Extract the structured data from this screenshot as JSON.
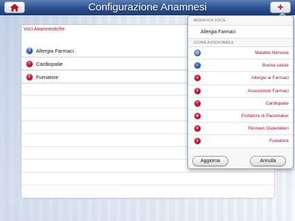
{
  "header": {
    "title": "Configurazione Anamnesi"
  },
  "main": {
    "section_label": "Voci Anamnestiche",
    "items": [
      {
        "label": "Allergia Farmaci",
        "icon": "allergy-pill-icon"
      },
      {
        "label": "Cardiopatie",
        "icon": "heartbeat-icon"
      },
      {
        "label": "Fumatore",
        "icon": "cigarette-icon"
      }
    ]
  },
  "popover": {
    "edit_label": "MODIFICA VOCE",
    "edit_value": "Allergia Farmaci",
    "icons_label": "ICONA ASSOCIABILE",
    "icons": [
      {
        "label": "Malattie Nervose",
        "icon": "brain-icon"
      },
      {
        "label": "Buona salute",
        "icon": "thermometer-icon"
      },
      {
        "label": "Allergie ai Farmaci",
        "icon": "allergy-pill-icon"
      },
      {
        "label": "Assunzione Farmaci",
        "icon": "capsule-icon"
      },
      {
        "label": "Cardiopatie",
        "icon": "heartbeat-icon"
      },
      {
        "label": "Portatore di Pacemaker",
        "icon": "pacemaker-icon"
      },
      {
        "label": "Ricoveri Ospedalieri",
        "icon": "hospital-bed-icon"
      },
      {
        "label": "Fumatore",
        "icon": "cigarette-icon"
      }
    ],
    "save_label": "Aggiorna",
    "cancel_label": "Annulla"
  },
  "colors": {
    "accent": "#b0103a",
    "header": "#2b4f8e"
  }
}
